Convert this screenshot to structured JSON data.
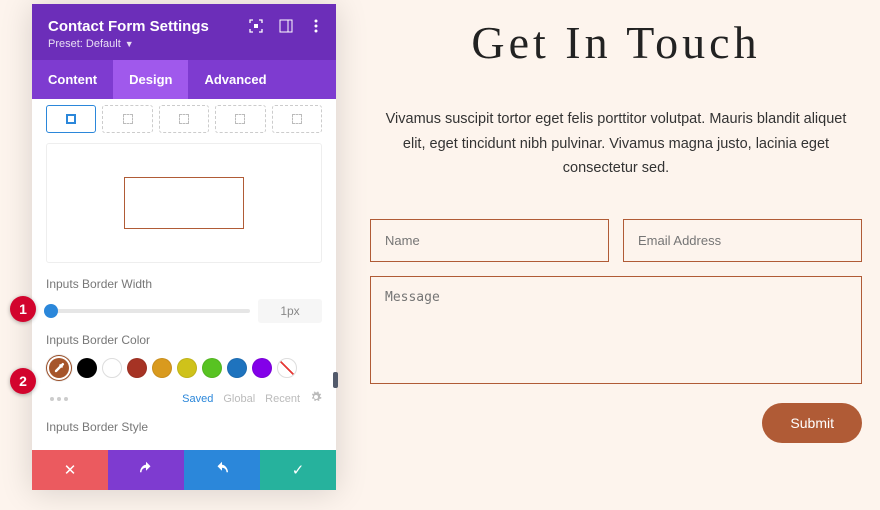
{
  "panel": {
    "title": "Contact Form Settings",
    "preset_label": "Preset: Default",
    "tabs": [
      "Content",
      "Design",
      "Advanced"
    ],
    "active_tab": 1,
    "preview_border_color": "#b05b36",
    "border_width": {
      "label": "Inputs Border Width",
      "value": "1px"
    },
    "border_color": {
      "label": "Inputs Border Color",
      "swatches": [
        {
          "name": "eyedropper-selected",
          "color": "#a6552b"
        },
        {
          "name": "black",
          "color": "#000000"
        },
        {
          "name": "white",
          "color": "#ffffff"
        },
        {
          "name": "red",
          "color": "#a63324"
        },
        {
          "name": "orange",
          "color": "#d99a1e"
        },
        {
          "name": "yellow",
          "color": "#cfc21a"
        },
        {
          "name": "green",
          "color": "#58c322"
        },
        {
          "name": "blue",
          "color": "#1e73be"
        },
        {
          "name": "purple",
          "color": "#8300e9"
        },
        {
          "name": "none",
          "color": "none"
        }
      ]
    },
    "saved_row": {
      "saved": "Saved",
      "global": "Global",
      "recent": "Recent"
    },
    "border_style_label": "Inputs Border Style",
    "header_icons": [
      "focus-icon",
      "layout-icon",
      "kebab-icon"
    ],
    "actions": [
      "close",
      "undo",
      "redo",
      "confirm"
    ]
  },
  "callouts": [
    "1",
    "2"
  ],
  "page": {
    "title": "Get In Touch",
    "description": "Vivamus suscipit tortor eget felis porttitor volutpat. Mauris blandit aliquet elit, eget tincidunt nibh pulvinar. Vivamus magna justo, lacinia eget consectetur sed.",
    "fields": {
      "name_placeholder": "Name",
      "email_placeholder": "Email Address",
      "message_placeholder": "Message"
    },
    "submit_label": "Submit"
  }
}
